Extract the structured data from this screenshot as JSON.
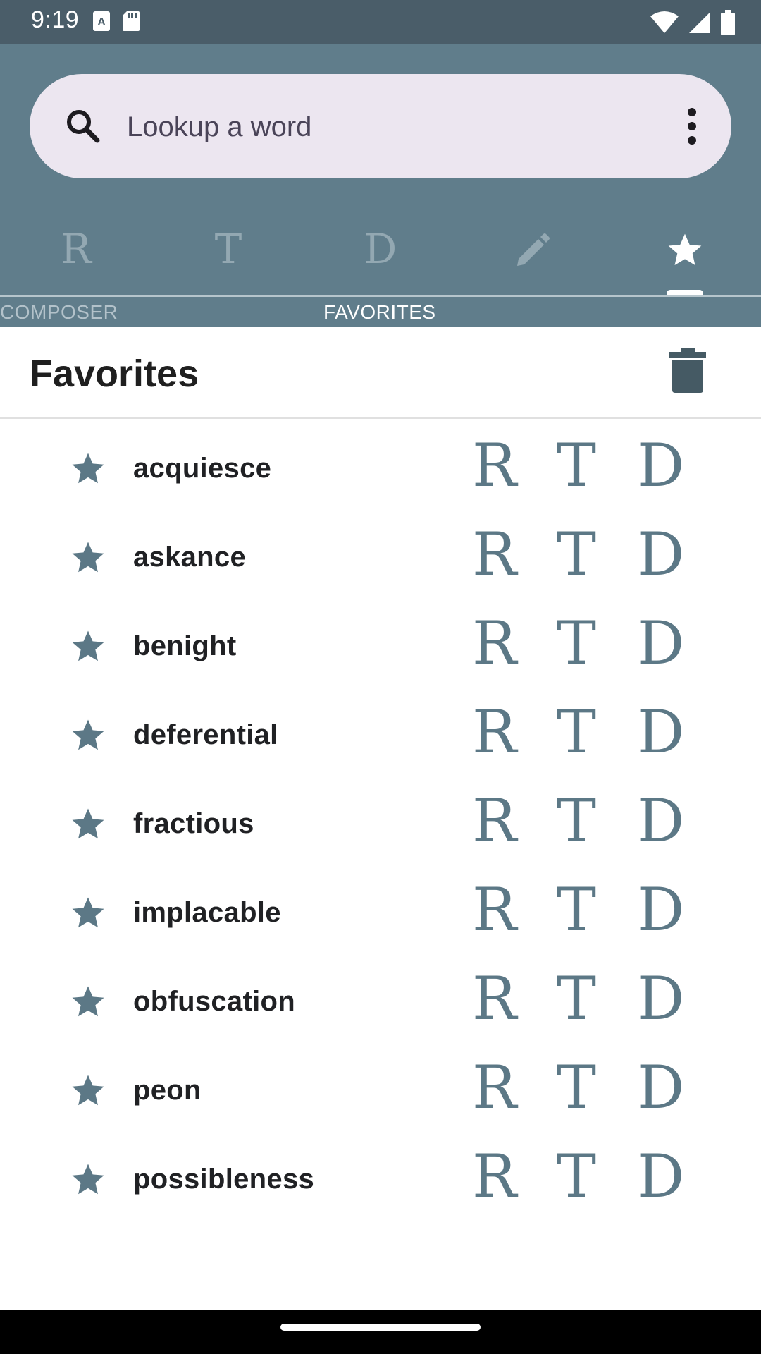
{
  "status_bar": {
    "time": "9:19",
    "icons": [
      "font-download-icon",
      "sd-card-icon",
      "wifi-icon",
      "signal-icon",
      "battery-icon"
    ]
  },
  "search": {
    "placeholder": "Lookup a word",
    "value": ""
  },
  "tabs": [
    {
      "icon": "rhyme-r",
      "glyph": "R",
      "selected": false
    },
    {
      "icon": "thesaurus-t",
      "glyph": "T",
      "selected": false
    },
    {
      "icon": "definition-d",
      "glyph": "D",
      "selected": false
    },
    {
      "icon": "pencil-icon",
      "glyph": "",
      "selected": false
    },
    {
      "icon": "star-icon",
      "glyph": "",
      "selected": true
    }
  ],
  "tab_labels": {
    "composer": "COMPOSER",
    "favorites": "FAVORITES"
  },
  "page": {
    "title": "Favorites"
  },
  "favorites": [
    {
      "word": "acquiesce",
      "r": "R",
      "t": "T",
      "d": "D"
    },
    {
      "word": "askance",
      "r": "R",
      "t": "T",
      "d": "D"
    },
    {
      "word": "benight",
      "r": "R",
      "t": "T",
      "d": "D"
    },
    {
      "word": "deferential",
      "r": "R",
      "t": "T",
      "d": "D"
    },
    {
      "word": "fractious",
      "r": "R",
      "t": "T",
      "d": "D"
    },
    {
      "word": "implacable",
      "r": "R",
      "t": "T",
      "d": "D"
    },
    {
      "word": "obfuscation",
      "r": "R",
      "t": "T",
      "d": "D"
    },
    {
      "word": "peon",
      "r": "R",
      "t": "T",
      "d": "D"
    },
    {
      "word": "possibleness",
      "r": "R",
      "t": "T",
      "d": "D"
    }
  ],
  "colors": {
    "status_bar": "#4a5d69",
    "app_bar": "#607d8b",
    "search_pill": "#ece6f0",
    "accent_icon": "#5c7886",
    "tab_inactive": "#93a8b2",
    "tab_active": "#ffffff"
  }
}
